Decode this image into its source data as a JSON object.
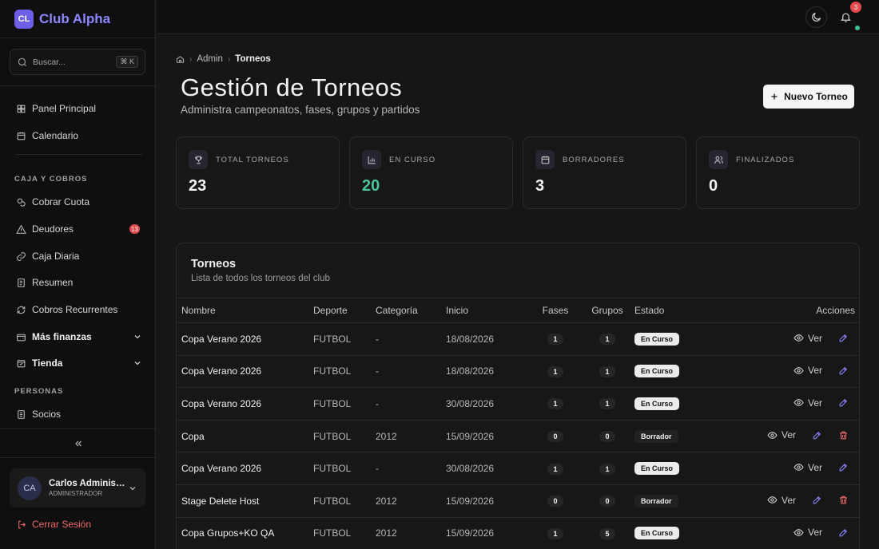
{
  "brand": {
    "logo": "CL",
    "name": "Club Alpha"
  },
  "search": {
    "placeholder": "Buscar...",
    "shortcut": "⌘ K"
  },
  "sidebar": {
    "top_items": [
      {
        "label": "Panel Principal",
        "icon": "dashboard-icon"
      },
      {
        "label": "Calendario",
        "icon": "calendar-icon"
      }
    ],
    "section_caja": "CAJA Y COBROS",
    "caja_items": [
      {
        "label": "Cobrar Cuota",
        "icon": "coins-icon"
      },
      {
        "label": "Deudores",
        "icon": "alert-icon",
        "badge": "13"
      },
      {
        "label": "Caja Diaria",
        "icon": "link-icon"
      },
      {
        "label": "Resumen",
        "icon": "receipt-icon"
      },
      {
        "label": "Cobros Recurrentes",
        "icon": "repeat-icon"
      }
    ],
    "groups": [
      {
        "label": "Más finanzas",
        "icon": "wallet-icon"
      },
      {
        "label": "Tienda",
        "icon": "store-icon"
      }
    ],
    "section_personas": "PERSONAS",
    "personas_items": [
      {
        "label": "Socios",
        "icon": "id-card-icon"
      }
    ]
  },
  "user": {
    "initials": "CA",
    "name": "Carlos Administrador",
    "role": "ADMINISTRADOR"
  },
  "logout_label": "Cerrar Sesión",
  "topbar": {
    "notifications": "3"
  },
  "breadcrumb": {
    "level1": "Admin",
    "current": "Torneos"
  },
  "page": {
    "title": "Gestión de Torneos",
    "subtitle": "Administra campeonatos, fases, grupos y partidos",
    "new_button": "Nuevo Torneo"
  },
  "stats": [
    {
      "label": "TOTAL TORNEOS",
      "value": "23",
      "icon": "trophy-icon"
    },
    {
      "label": "EN CURSO",
      "value": "20",
      "icon": "chart-icon"
    },
    {
      "label": "BORRADORES",
      "value": "3",
      "icon": "calendar-icon"
    },
    {
      "label": "FINALIZADOS",
      "value": "0",
      "icon": "users-icon"
    }
  ],
  "table": {
    "title": "Torneos",
    "subtitle": "Lista de todos los torneos del club",
    "columns": [
      "Nombre",
      "Deporte",
      "Categoría",
      "Inicio",
      "Fases",
      "Grupos",
      "Estado",
      "Acciones"
    ],
    "view_label": "Ver",
    "rows": [
      {
        "nombre": "Copa Verano 2026",
        "deporte": "FUTBOL",
        "categoria": "-",
        "inicio": "18/08/2026",
        "fases": "1",
        "grupos": "1",
        "estado": "En Curso"
      },
      {
        "nombre": "Copa Verano 2026",
        "deporte": "FUTBOL",
        "categoria": "-",
        "inicio": "18/08/2026",
        "fases": "1",
        "grupos": "1",
        "estado": "En Curso"
      },
      {
        "nombre": "Copa Verano 2026",
        "deporte": "FUTBOL",
        "categoria": "-",
        "inicio": "30/08/2026",
        "fases": "1",
        "grupos": "1",
        "estado": "En Curso"
      },
      {
        "nombre": "Copa",
        "deporte": "FUTBOL",
        "categoria": "2012",
        "inicio": "15/09/2026",
        "fases": "0",
        "grupos": "0",
        "estado": "Borrador"
      },
      {
        "nombre": "Copa Verano 2026",
        "deporte": "FUTBOL",
        "categoria": "-",
        "inicio": "30/08/2026",
        "fases": "1",
        "grupos": "1",
        "estado": "En Curso"
      },
      {
        "nombre": "Stage Delete Host",
        "deporte": "FUTBOL",
        "categoria": "2012",
        "inicio": "15/09/2026",
        "fases": "0",
        "grupos": "0",
        "estado": "Borrador"
      },
      {
        "nombre": "Copa Grupos+KO QA",
        "deporte": "FUTBOL",
        "categoria": "2012",
        "inicio": "15/09/2026",
        "fases": "1",
        "grupos": "5",
        "estado": "En Curso"
      }
    ]
  },
  "colors": {
    "accent": "#8d87ff",
    "success": "#4cc39a",
    "danger": "#e5484d",
    "background": "#161616"
  }
}
